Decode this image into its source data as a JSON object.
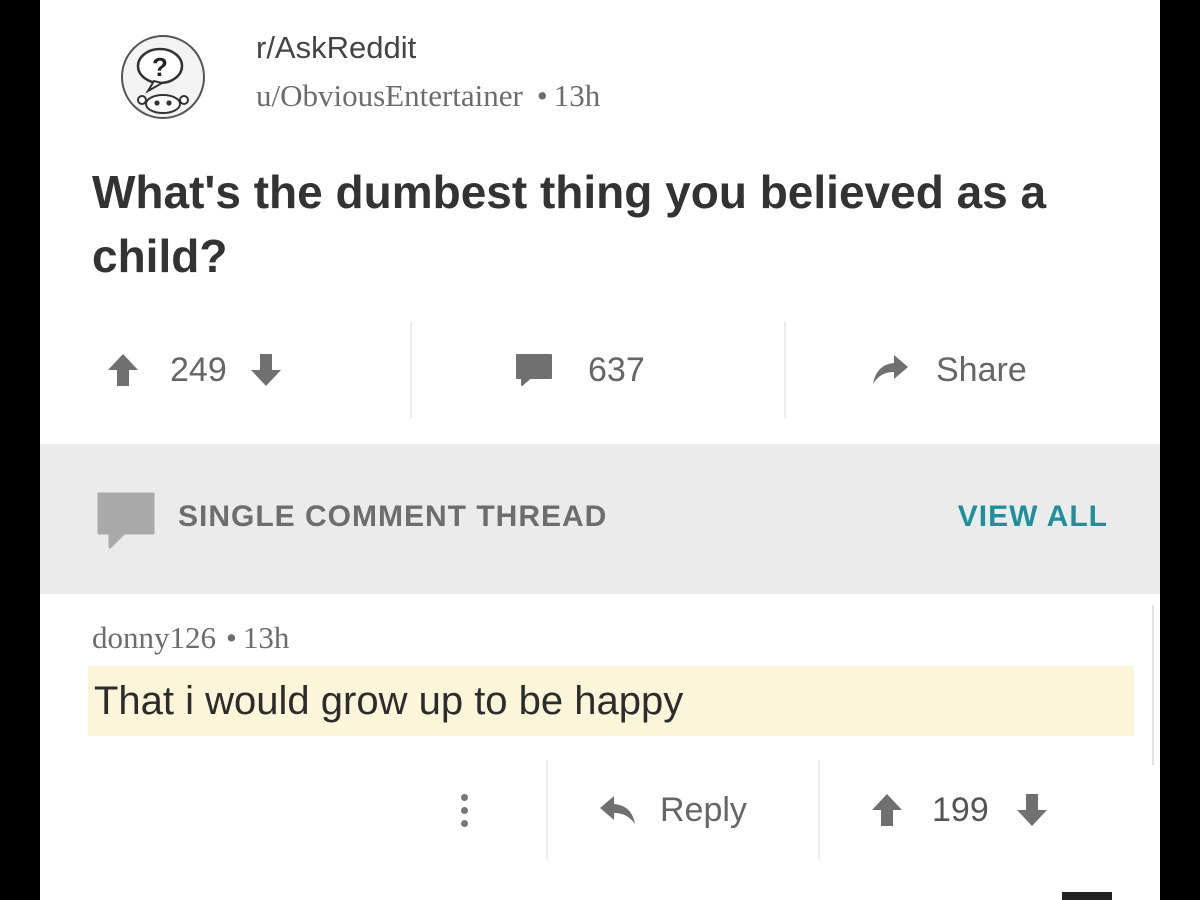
{
  "post": {
    "subreddit": "r/AskReddit",
    "author": "u/ObviousEntertainer",
    "separator": "•",
    "age": "13h",
    "title": "What's the dumbest thing you believed as a child?",
    "upvotes": "249",
    "comments": "637",
    "share_label": "Share"
  },
  "thread": {
    "label": "SINGLE COMMENT THREAD",
    "view_all_label": "VIEW ALL"
  },
  "comment": {
    "author": "donny126",
    "separator": "•",
    "age": "13h",
    "body": "That i would grow up to be happy",
    "reply_label": "Reply",
    "votes": "199"
  },
  "icons": {
    "subreddit": "askreddit-snoo-icon",
    "upvote": "arrow-up-icon",
    "downvote": "arrow-down-icon",
    "comments": "speech-bubble-icon",
    "share": "share-arrow-icon",
    "reply": "reply-arrow-icon",
    "more": "kebab-icon"
  },
  "colors": {
    "accent": "#1f8f9b",
    "highlight": "#fbf6d9",
    "thread_bar": "#ebebeb"
  }
}
